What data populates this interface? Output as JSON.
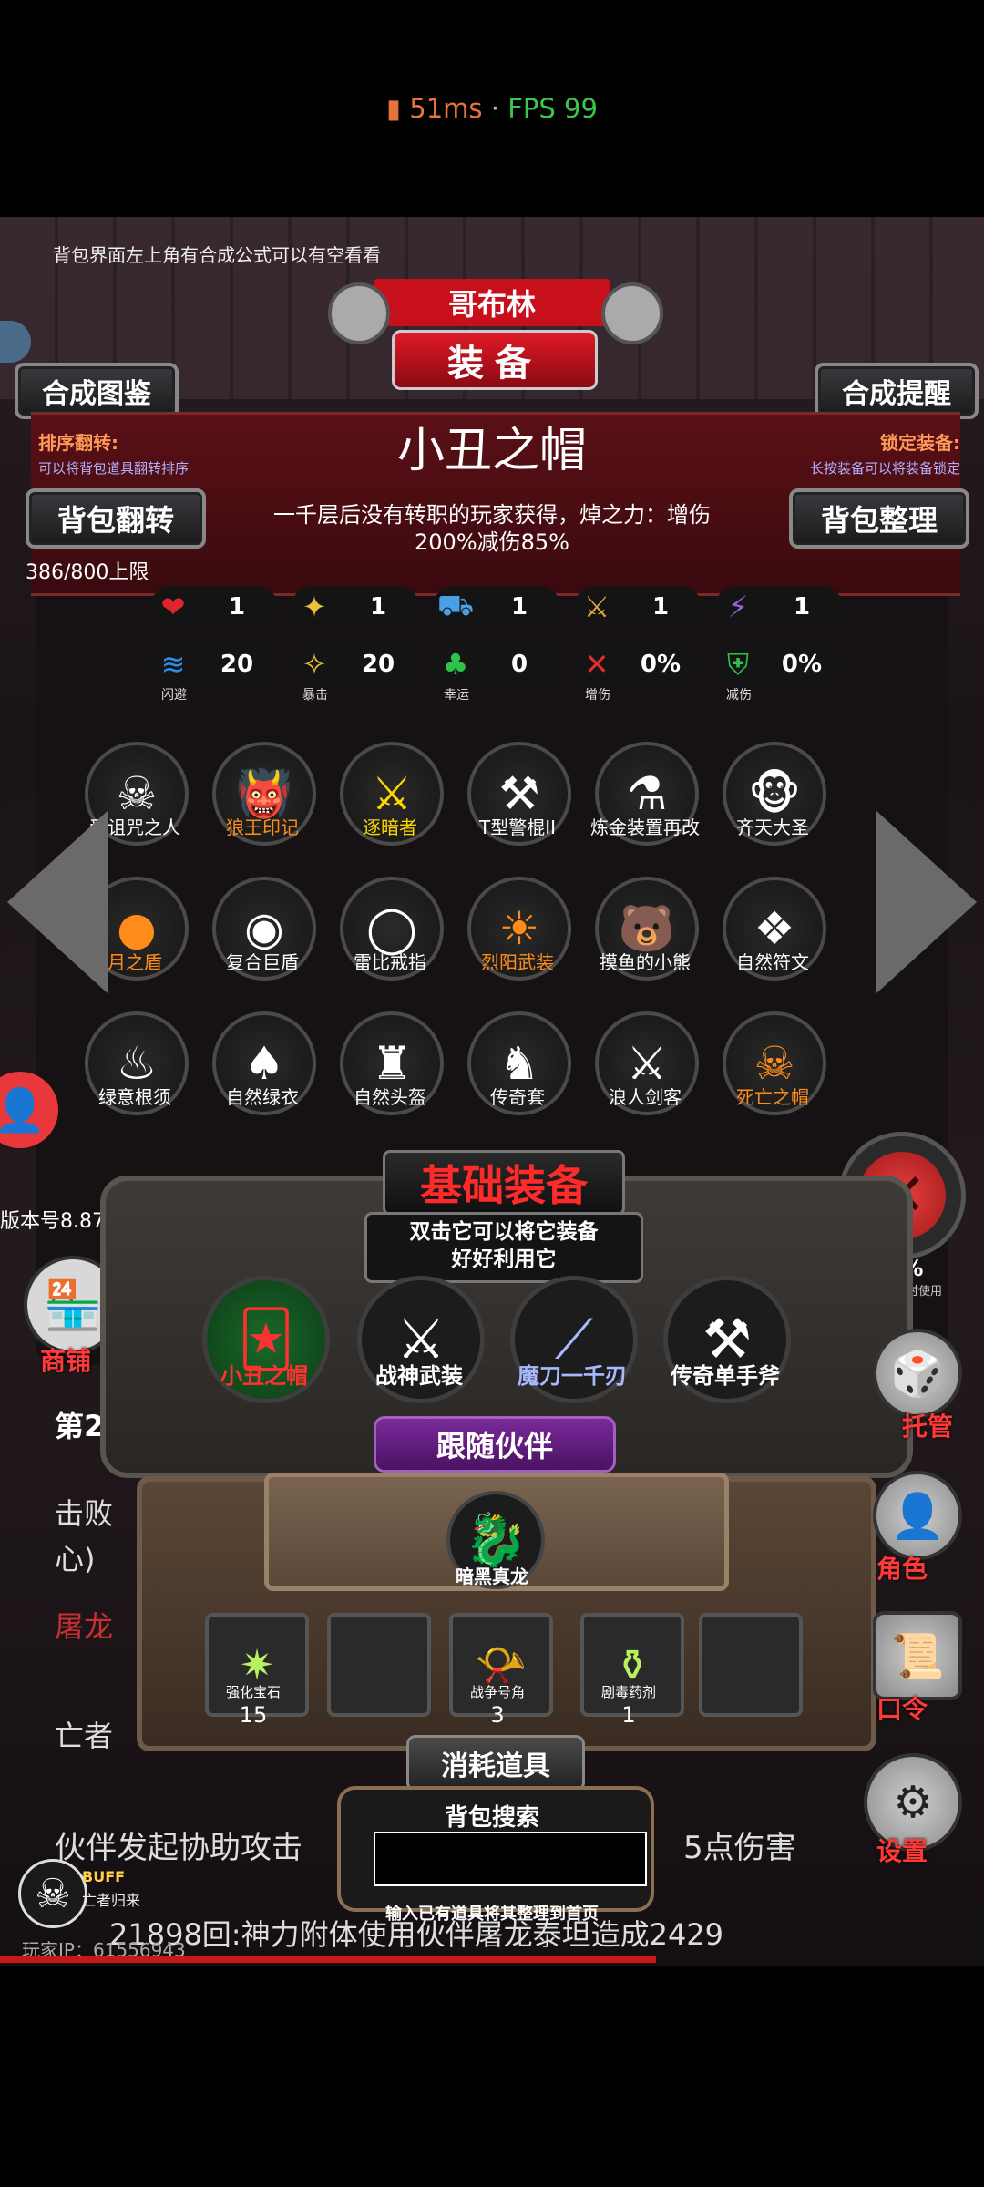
{
  "status_bar": {
    "ping": "51ms",
    "fps": "FPS 99",
    "separator": "·"
  },
  "game": {
    "tip_text": "背包界面左上角有合成公式可以有空看看",
    "location_name": "哥布林",
    "title": "装备",
    "buttons": {
      "synth_guide": "合成图鉴",
      "synth_remind": "合成提醒",
      "bag_flip": "背包翻转",
      "bag_sort": "背包整理"
    },
    "sort_flip": {
      "label": "排序翻转:",
      "desc": "可以将背包道具翻转排序"
    },
    "lock_equip": {
      "label": "锁定装备:",
      "desc": "长按装备可以将装备锁定"
    },
    "item": {
      "name": "小丑之帽",
      "desc_line1": "一千层后没有转职的玩家获得，焯之力：增伤",
      "desc_line2": "200%减伤85%"
    },
    "capacity": "386/800上限",
    "stats_row1": [
      {
        "icon": "heart-icon",
        "glyph": "❤",
        "color": "#e0242c",
        "value": "1"
      },
      {
        "icon": "armor-icon",
        "glyph": "✦",
        "color": "#e7c23a",
        "value": "1"
      },
      {
        "icon": "car-icon",
        "glyph": "⛟",
        "color": "#4aa0e6",
        "value": "1"
      },
      {
        "icon": "sword-icon",
        "glyph": "⚔",
        "color": "#e0a43a",
        "value": "1"
      },
      {
        "icon": "lightning-icon",
        "glyph": "⚡",
        "color": "#9b5de0",
        "value": "1"
      }
    ],
    "stats_row2": [
      {
        "icon": "dodge-icon",
        "glyph": "≋",
        "color": "#2f8ee8",
        "value": "20",
        "label": "闪避"
      },
      {
        "icon": "crit-icon",
        "glyph": "✧",
        "color": "#e7c23a",
        "value": "20",
        "label": "暴击"
      },
      {
        "icon": "clover-icon",
        "glyph": "♣",
        "color": "#2fc24a",
        "value": "0",
        "label": "幸运"
      },
      {
        "icon": "damage-boost-icon",
        "glyph": "✕",
        "color": "#e02c2c",
        "value": "0%",
        "label": "增伤"
      },
      {
        "icon": "shield-icon",
        "glyph": "⛨",
        "color": "#2fc24a",
        "value": "0%",
        "label": "减伤"
      }
    ],
    "bag_items": [
      {
        "label": "受诅咒之人",
        "glyph": "☠",
        "color": "#ffffff"
      },
      {
        "label": "狼王印记",
        "glyph": "👹",
        "color": "#ff8c1a"
      },
      {
        "label": "逐暗者",
        "glyph": "⚔",
        "color": "#ffd700"
      },
      {
        "label": "T型警棍II",
        "glyph": "⚒",
        "color": "#ffffff"
      },
      {
        "label": "炼金装置再改",
        "glyph": "⚗",
        "color": "#ffffff"
      },
      {
        "label": "齐天大圣",
        "glyph": "🐵",
        "color": "#ffffff"
      },
      {
        "label": "月之盾",
        "glyph": "●",
        "color": "#ff8c1a"
      },
      {
        "label": "复合巨盾",
        "glyph": "◉",
        "color": "#ffffff"
      },
      {
        "label": "雷比戒指",
        "glyph": "◯",
        "color": "#ffffff"
      },
      {
        "label": "烈阳武装",
        "glyph": "☀",
        "color": "#ff8c1a"
      },
      {
        "label": "摸鱼的小熊",
        "glyph": "🐻",
        "color": "#ffffff"
      },
      {
        "label": "自然符文",
        "glyph": "❖",
        "color": "#ffffff"
      },
      {
        "label": "绿意根须",
        "glyph": "♨",
        "color": "#ffffff"
      },
      {
        "label": "自然绿衣",
        "glyph": "♠",
        "color": "#ffffff"
      },
      {
        "label": "自然头盔",
        "glyph": "♜",
        "color": "#ffffff"
      },
      {
        "label": "传奇套",
        "glyph": "♞",
        "color": "#ffffff"
      },
      {
        "label": "浪人剑客",
        "glyph": "⚔",
        "color": "#ffffff"
      },
      {
        "label": "死亡之帽",
        "glyph": "☠",
        "color": "#ff8c1a"
      }
    ],
    "version": "版本号8.87",
    "basic_equip": {
      "title": "基础装备",
      "hint_line1": "双击它可以将它装备",
      "hint_line2": "好好利用它",
      "items": [
        {
          "label": "小丑之帽",
          "glyph": "🃏",
          "color": "#ff3030"
        },
        {
          "label": "战神武装",
          "glyph": "⚔",
          "color": "#ffffff"
        },
        {
          "label": "魔刀一千刃",
          "glyph": "⟋",
          "color": "#a8b8ff"
        },
        {
          "label": "传奇单手斧",
          "glyph": "⚒",
          "color": "#ffffff"
        }
      ]
    },
    "companion": {
      "title": "跟随伙伴",
      "name": "暗黑真龙",
      "glyph": "🐉"
    },
    "consumables": {
      "title": "消耗道具",
      "items": [
        {
          "label": "强化宝石",
          "count": "15",
          "glyph": "✷"
        },
        {
          "label": "",
          "count": "",
          "glyph": ""
        },
        {
          "label": "战争号角",
          "count": "3",
          "glyph": "📯"
        },
        {
          "label": "剧毒药剂",
          "count": "1",
          "glyph": "⚱"
        },
        {
          "label": "",
          "count": "",
          "glyph": ""
        }
      ]
    },
    "search": {
      "title": "背包搜索",
      "placeholder": "",
      "hint": "输入已有道具将其整理到首页"
    },
    "side_menu": {
      "shop": "商铺",
      "manage": "托管",
      "role": "角色",
      "code": "口令",
      "settings": "设置"
    },
    "right_small": {
      "value": "30%",
      "desc": "其数值时使用"
    },
    "background_log": {
      "line1": "第2",
      "line2": "击败",
      "line3": "心)",
      "line4": "屠龙",
      "line5": "亡者",
      "line6": "伙伴发起协助攻击",
      "line6b": "5点伤害",
      "line7": "21898回:神力附体使用伙伴屠龙泰坦造成2429"
    },
    "buff": {
      "label": "BUFF",
      "desc": "亡者归来"
    },
    "player_ip": "玩家IP：61556943",
    "colors": {
      "accent_red": "#c8101c",
      "rare_orange": "#ff8c1a",
      "legend_yellow": "#ffd700"
    }
  }
}
